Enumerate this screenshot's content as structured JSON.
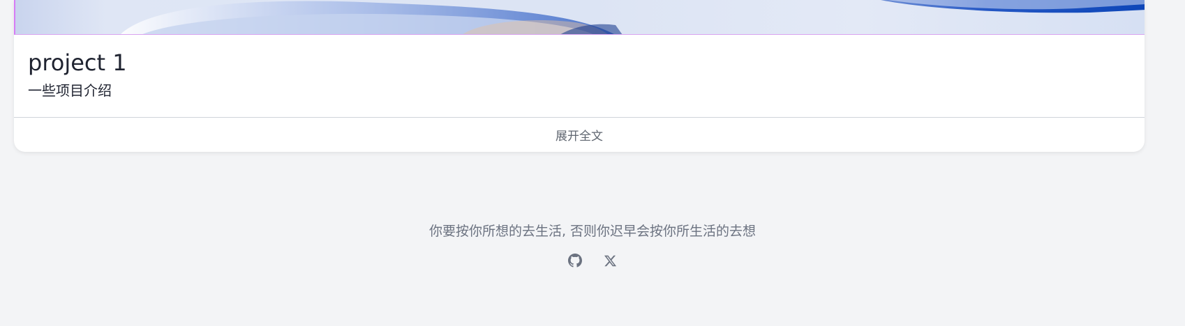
{
  "card": {
    "title": "project 1",
    "description": "一些项目介绍",
    "expand_label": "展开全文"
  },
  "footer": {
    "quote": "你要按你所想的去生活, 否则你迟早会按你所生活的去想",
    "social": [
      {
        "icon": "github-icon"
      },
      {
        "icon": "x-icon"
      }
    ]
  }
}
